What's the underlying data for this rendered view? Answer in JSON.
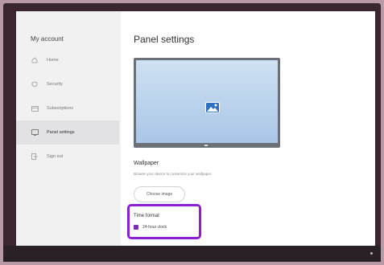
{
  "sidebar": {
    "title": "My account",
    "items": [
      {
        "label": "Home",
        "icon": "home-icon"
      },
      {
        "label": "Security",
        "icon": "shield-icon"
      },
      {
        "label": "Subscriptions",
        "icon": "card-icon"
      },
      {
        "label": "Panel settings",
        "icon": "panel-icon",
        "active": true
      },
      {
        "label": "Sign out",
        "icon": "signout-icon"
      }
    ]
  },
  "main": {
    "title": "Panel settings",
    "wallpaper": {
      "title": "Wallpaper",
      "description": "Browse your device to customize your wallpaper.",
      "button": "Choose image"
    },
    "time_format": {
      "title": "Time format",
      "option": "24-hour clock",
      "checked": true
    }
  },
  "colors": {
    "accent": "#8b1fd1",
    "checkbox": "#7c2bb5"
  }
}
